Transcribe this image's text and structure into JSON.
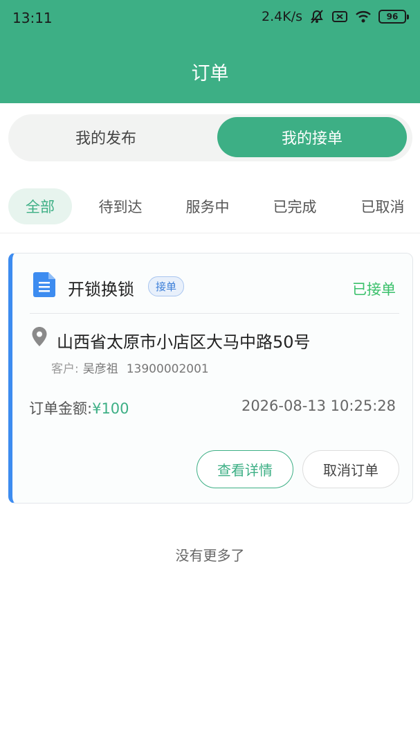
{
  "status_bar": {
    "time": "13:11",
    "net_speed": "2.4K/s",
    "battery": "96"
  },
  "header": {
    "title": "订单"
  },
  "segmented": {
    "left_label": "我的发布",
    "right_label": "我的接单",
    "selected": "我的接单"
  },
  "tabs": [
    {
      "label": "全部",
      "active": true
    },
    {
      "label": "待到达",
      "active": false
    },
    {
      "label": "服务中",
      "active": false
    },
    {
      "label": "已完成",
      "active": false
    },
    {
      "label": "已取消",
      "active": false
    }
  ],
  "order": {
    "service": "开锁换锁",
    "tag": "接单",
    "status": "已接单",
    "address": "山西省太原市小店区大马中路50号",
    "customer_label": "客户:",
    "customer_name": "吴彦祖",
    "customer_phone": "13900002001",
    "amount_label": "订单金额:",
    "amount_value": "¥100",
    "datetime": "2026-08-13 10:25:28",
    "detail_button": "查看详情",
    "cancel_button": "取消订单"
  },
  "footer": {
    "no_more": "没有更多了"
  },
  "colors": {
    "primary": "#3daf85",
    "accent_blue": "#3d8cf0",
    "status_green": "#3ac06a"
  }
}
